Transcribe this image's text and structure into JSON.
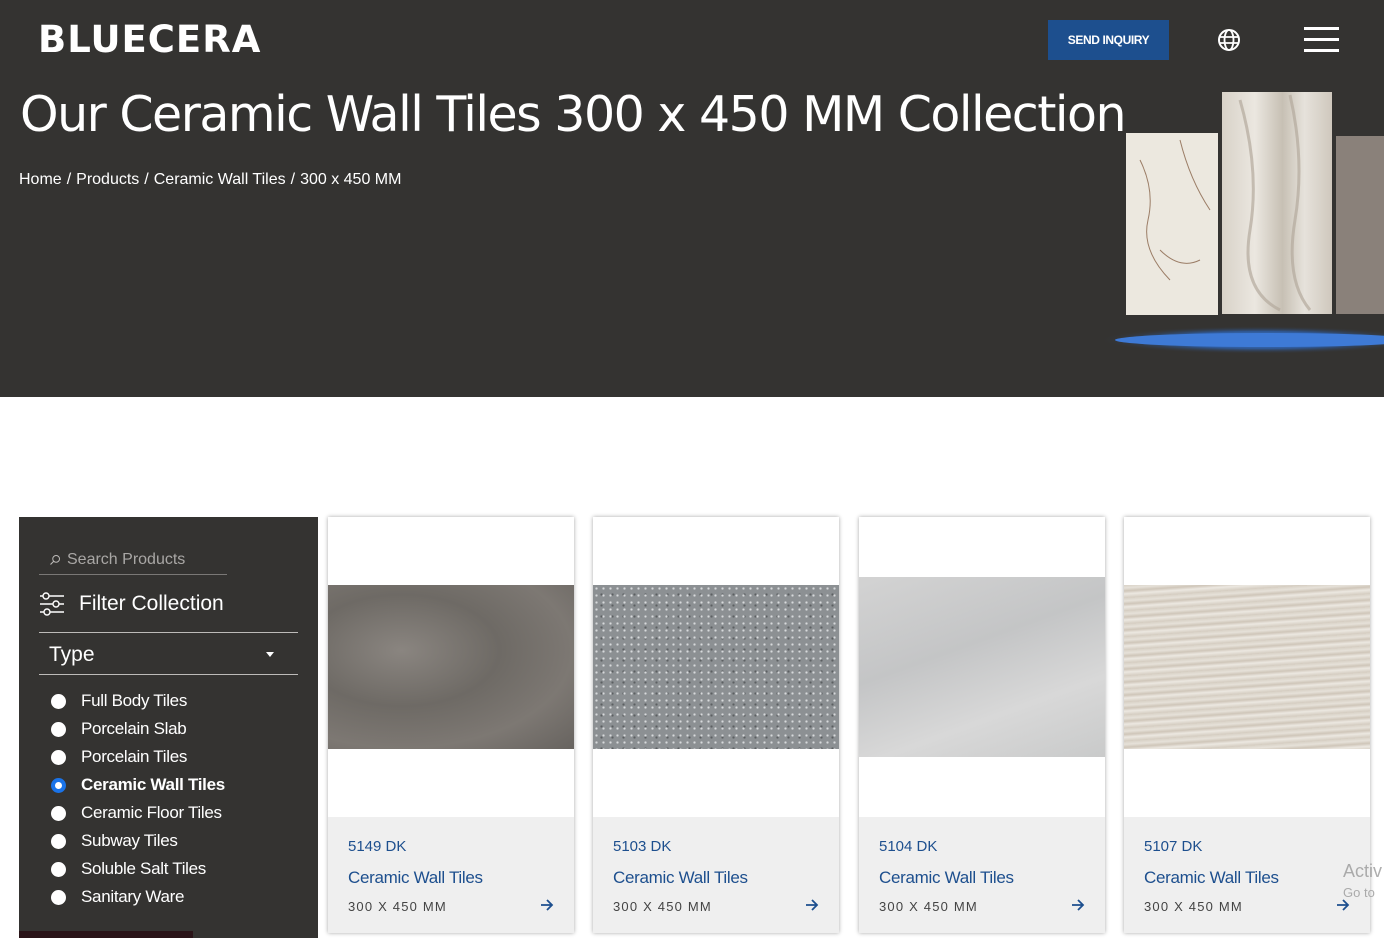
{
  "header": {
    "logo": "BLUECERA",
    "inquiry_button": "SEND INQUIRY",
    "globe_icon": "globe-icon",
    "menu_icon": "hamburger-menu-icon"
  },
  "hero": {
    "title": "Our Ceramic Wall Tiles 300 x 450 MM Collection",
    "breadcrumb": [
      "Home",
      "Products",
      "Ceramic Wall Tiles",
      "300 x 450 MM"
    ],
    "breadcrumb_separator": "/"
  },
  "sidebar": {
    "search_placeholder": "Search Products",
    "filter_title": "Filter Collection",
    "type_label": "Type",
    "types": [
      {
        "label": "Full Body Tiles",
        "checked": false
      },
      {
        "label": "Porcelain Slab",
        "checked": false
      },
      {
        "label": "Porcelain Tiles",
        "checked": false
      },
      {
        "label": "Ceramic Wall Tiles",
        "checked": true
      },
      {
        "label": "Ceramic Floor Tiles",
        "checked": false
      },
      {
        "label": "Subway Tiles",
        "checked": false
      },
      {
        "label": "Soluble Salt Tiles",
        "checked": false
      },
      {
        "label": "Sanitary Ware",
        "checked": false
      }
    ]
  },
  "products": [
    {
      "code": "5149 DK",
      "category": "Ceramic Wall Tiles",
      "size": "300 X 450 MM"
    },
    {
      "code": "5103 DK",
      "category": "Ceramic Wall Tiles",
      "size": "300 X 450 MM"
    },
    {
      "code": "5104 DK",
      "category": "Ceramic Wall Tiles",
      "size": "300 X 450 MM"
    },
    {
      "code": "5107 DK",
      "category": "Ceramic Wall Tiles",
      "size": "300 X 450 MM"
    }
  ],
  "watermark": {
    "line1": "Activ",
    "line2": "Go to"
  },
  "colors": {
    "accent": "#1d4f8e",
    "dark_bg": "#343331",
    "radio_checked": "#1a73e8"
  }
}
